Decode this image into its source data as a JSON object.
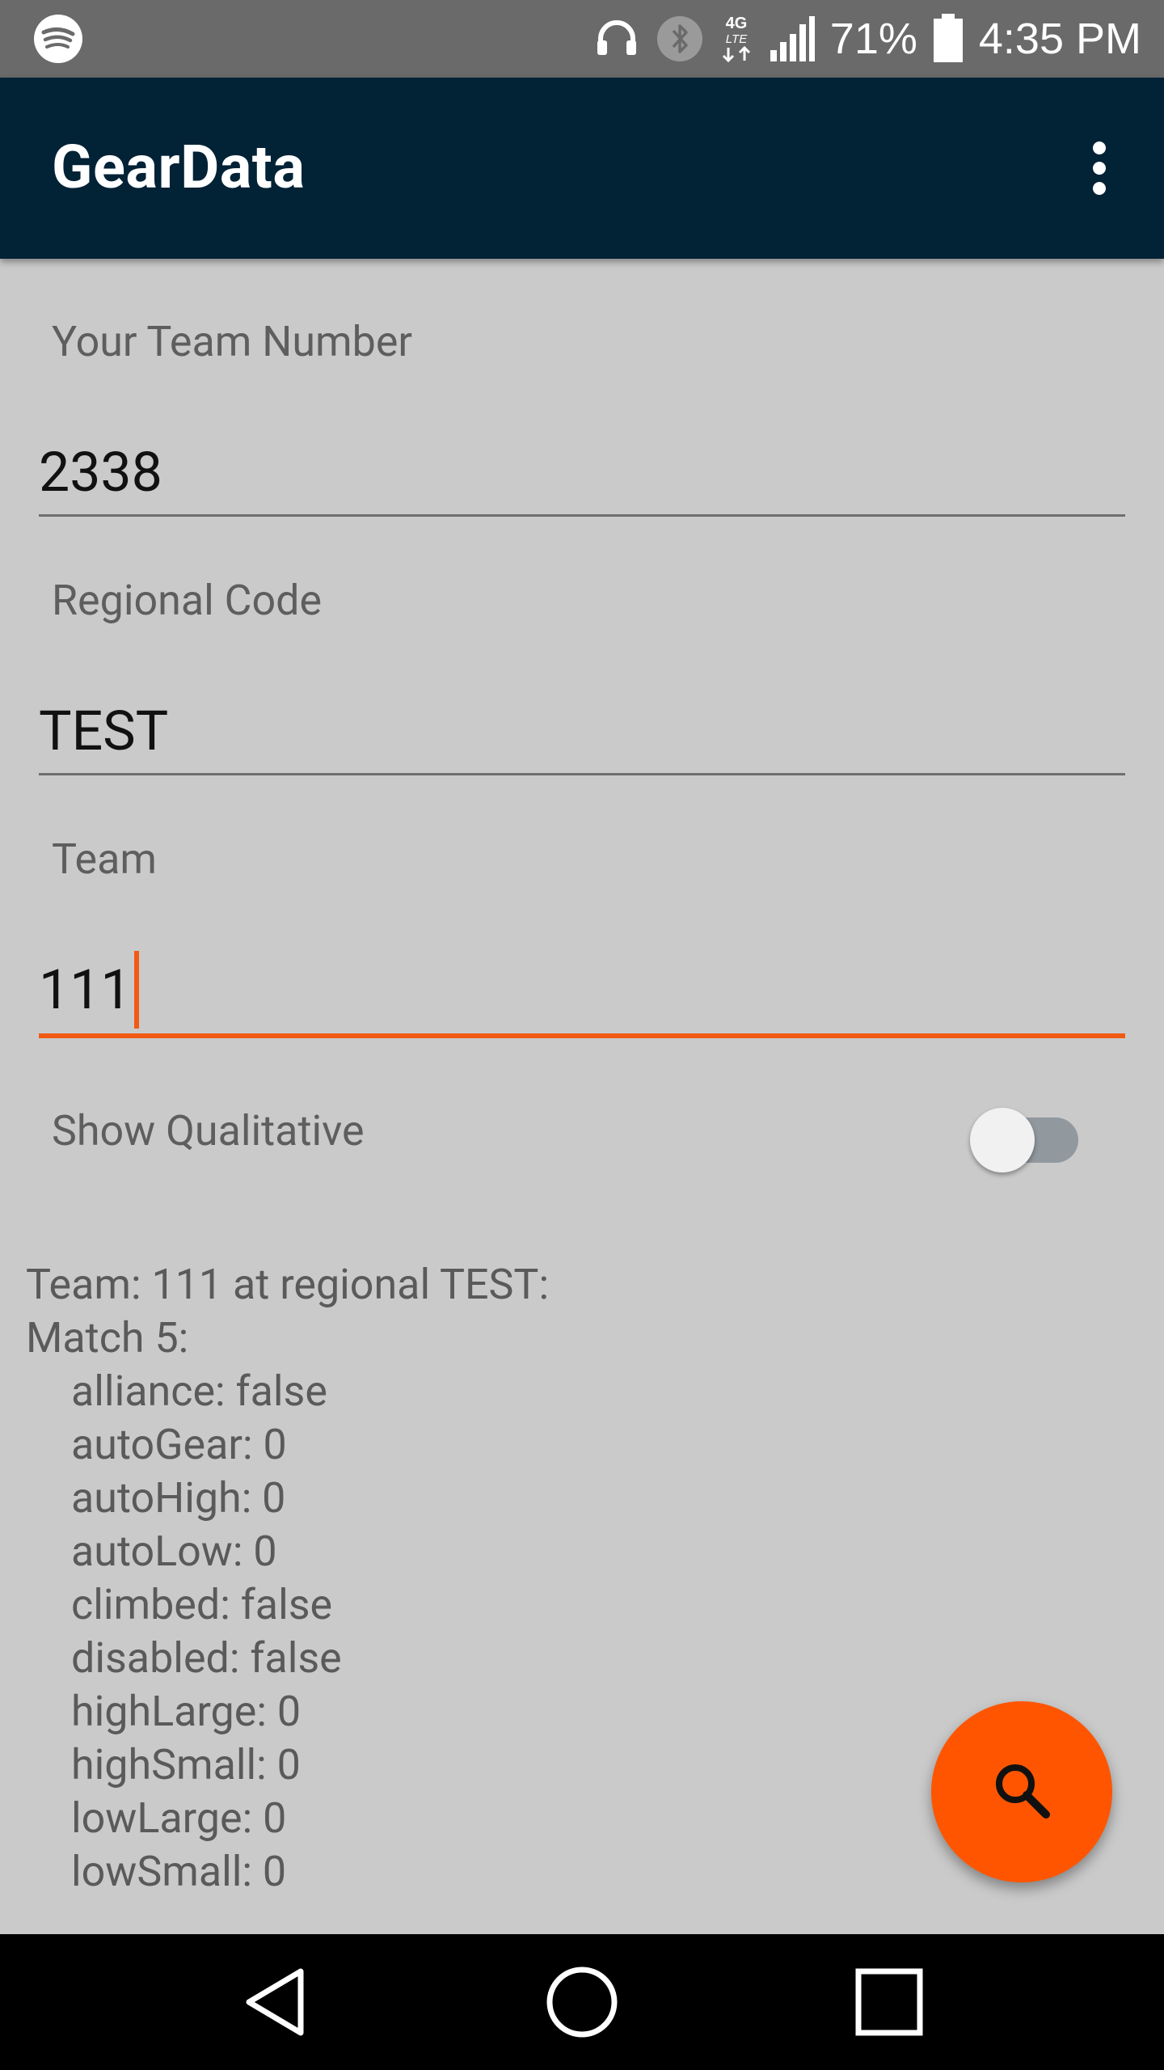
{
  "status_bar": {
    "battery_text": "71%",
    "time": "4:35 PM",
    "network_label": "4G LTE",
    "icons": [
      "spotify-icon",
      "headset-icon",
      "bluetooth-icon",
      "lte-icon",
      "signal-icon",
      "battery-icon"
    ]
  },
  "app_bar": {
    "title": "GearData",
    "overflow_icon": "more-vert-icon"
  },
  "form": {
    "team_number_label": "Your Team Number",
    "team_number_value": "2338",
    "regional_code_label": "Regional Code",
    "regional_code_value": "TEST",
    "team_label": "Team",
    "team_value": "111",
    "show_qualitative_label": "Show Qualitative",
    "show_qualitative_on": false
  },
  "results": {
    "header": "Team: 111 at regional TEST:",
    "match_label": "Match 5:",
    "fields": [
      "alliance: false",
      "autoGear: 0",
      "autoHigh: 0",
      "autoLow: 0",
      "climbed: false",
      "disabled: false",
      "highLarge: 0",
      "highSmall: 0",
      "lowLarge: 0",
      "lowSmall: 0"
    ]
  },
  "fab": {
    "icon": "search-icon"
  },
  "nav_bar": {
    "icons": [
      "back-icon",
      "home-icon",
      "recents-icon"
    ]
  },
  "colors": {
    "app_bar": "#022236",
    "accent": "#ff5500",
    "background": "#cacaca",
    "status_bar": "#6a6a6a"
  }
}
